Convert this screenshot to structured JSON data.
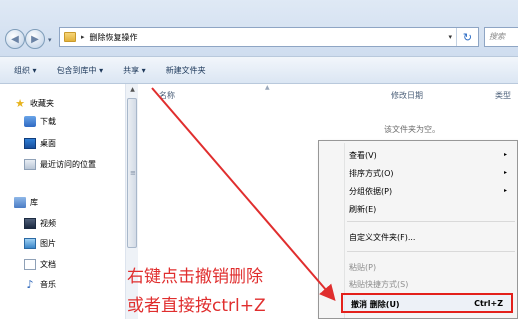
{
  "address_bar": {
    "breadcrumb_separator": "▸",
    "folder_path": "删除恢复操作",
    "search_placeholder": "搜索",
    "refresh_glyph": "↻",
    "dropdown_glyph": "▾"
  },
  "toolbar": {
    "organize": "组织 ▾",
    "include_in_library": "包含到库中 ▾",
    "share": "共享 ▾",
    "new_folder": "新建文件夹"
  },
  "sidebar": {
    "favorites": {
      "label": "收藏夹",
      "items": [
        {
          "label": "下载",
          "icon": "download-folder-icon"
        },
        {
          "label": "桌面",
          "icon": "desktop-icon"
        },
        {
          "label": "最近访问的位置",
          "icon": "recent-places-icon"
        }
      ]
    },
    "libraries": {
      "label": "库",
      "items": [
        {
          "label": "视频",
          "icon": "video-library-icon"
        },
        {
          "label": "图片",
          "icon": "pictures-library-icon"
        },
        {
          "label": "文档",
          "icon": "documents-library-icon"
        },
        {
          "label": "音乐",
          "icon": "music-library-icon"
        }
      ]
    }
  },
  "content": {
    "columns": [
      "名称",
      "修改日期",
      "类型"
    ],
    "empty_message": "该文件夹为空。"
  },
  "context_menu": {
    "items": [
      {
        "label": "查看(V)",
        "submenu": true,
        "enabled": true
      },
      {
        "label": "排序方式(O)",
        "submenu": true,
        "enabled": true
      },
      {
        "label": "分组依据(P)",
        "submenu": true,
        "enabled": true
      },
      {
        "label": "刷新(E)",
        "submenu": false,
        "enabled": true
      },
      {
        "label": "自定义文件夹(F)...",
        "submenu": false,
        "enabled": true
      },
      {
        "label": "粘贴(P)",
        "submenu": false,
        "enabled": false
      },
      {
        "label": "粘贴快捷方式(S)",
        "submenu": false,
        "enabled": false
      }
    ],
    "undo_item": {
      "label": "撤消 删除(U)",
      "shortcut": "Ctrl+Z"
    },
    "submenu_arrow": "▸"
  },
  "annotation": {
    "line1": "右键点击撤销删除",
    "line2": "或者直接按ctrl+Z",
    "color": "#e02e2e"
  }
}
